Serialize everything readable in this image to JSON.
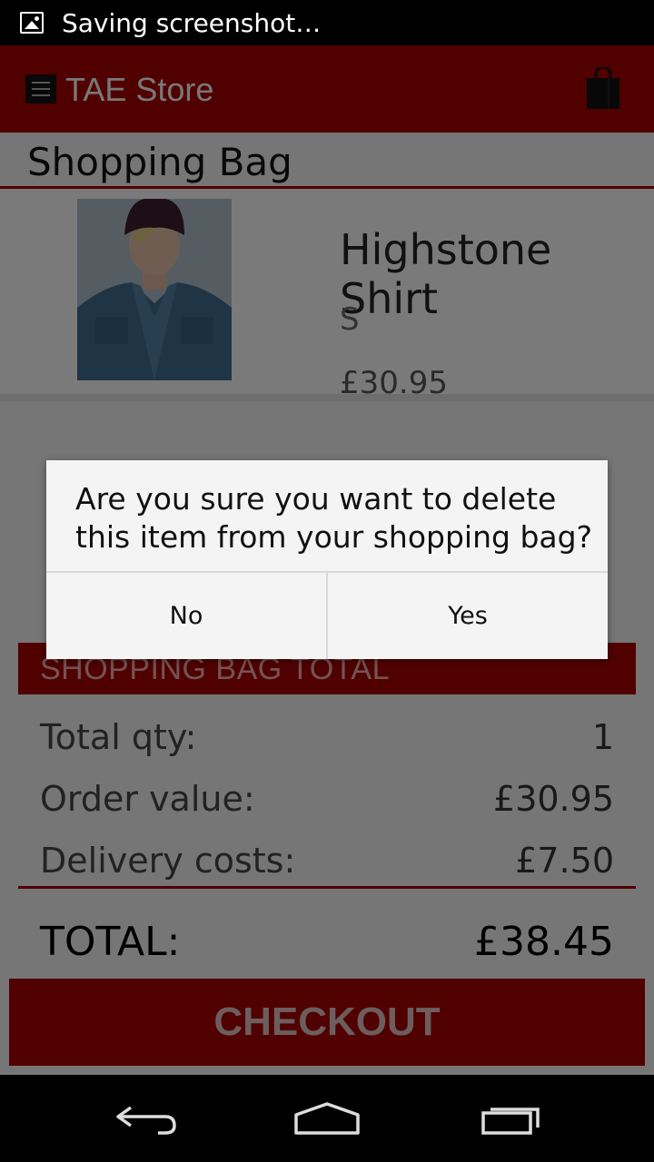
{
  "status_bar": {
    "text": "Saving screenshot…"
  },
  "toolbar": {
    "title": "TAE Store"
  },
  "bag": {
    "title": "Shopping Bag",
    "item": {
      "name": "Highstone Shirt",
      "size": "S",
      "price": "£30.95"
    }
  },
  "summary": {
    "header": "SHOPPING BAG TOTAL",
    "total_qty_label": "Total qty:",
    "total_qty_value": "1",
    "order_value_label": "Order value:",
    "order_value": "£30.95",
    "delivery_label": "Delivery costs:",
    "delivery_value": "£7.50",
    "total_label": "TOTAL:",
    "total_value": "£38.45"
  },
  "checkout": {
    "label": "CHECKOUT"
  },
  "dialog": {
    "message": "Are you sure you want to delete this item from your shopping bag?",
    "no_label": "No",
    "yes_label": "Yes"
  },
  "colors": {
    "brand_red": "#a30000",
    "dialog_bg": "#f4f4f4"
  },
  "icons": {
    "status": "image-icon",
    "menu": "hamburger-menu-icon",
    "bag": "shopping-bag-icon",
    "nav_back": "back-arrow-icon",
    "nav_home": "home-icon",
    "nav_recents": "recent-apps-icon"
  }
}
